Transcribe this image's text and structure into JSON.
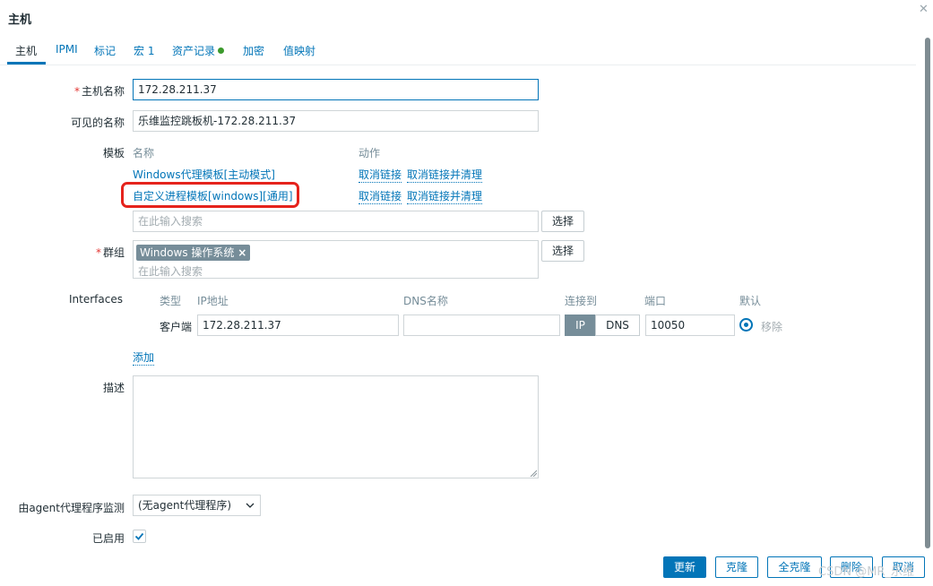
{
  "dialog": {
    "title": "主机",
    "close_icon": "close-icon"
  },
  "tabs": [
    {
      "label": "主机",
      "active": true
    },
    {
      "label": "IPMI"
    },
    {
      "label": "标记"
    },
    {
      "label": "宏 1"
    },
    {
      "label": "资产记录",
      "status_dot_color": "#3c9a2c"
    },
    {
      "label": "加密"
    },
    {
      "label": "值映射"
    }
  ],
  "form": {
    "host_name": {
      "required_mark": "*",
      "label": "主机名称",
      "value": "172.28.211.37"
    },
    "visible_name": {
      "label": "可见的名称",
      "value": "乐维监控跳板机-172.28.211.37"
    },
    "templates": {
      "label": "模板",
      "col_name": "名称",
      "col_action": "动作",
      "rows": [
        {
          "name": "Windows代理模板[主动模式]",
          "unlink": "取消链接",
          "unlink_clear": "取消链接并清理"
        },
        {
          "name": "自定义进程模板[windows][通用]",
          "unlink": "取消链接",
          "unlink_clear": "取消链接并清理"
        }
      ],
      "search_placeholder": "在此输入搜索",
      "select_button": "选择"
    },
    "groups": {
      "required_mark": "*",
      "label": "群组",
      "chip": "Windows 操作系统",
      "chip_remove": "×",
      "search_placeholder": "在此输入搜索",
      "select_button": "选择"
    },
    "interfaces": {
      "label": "Interfaces",
      "headers": {
        "type": "类型",
        "ip": "IP地址",
        "dns": "DNS名称",
        "connect": "连接到",
        "port": "端口",
        "default": "默认"
      },
      "row": {
        "type": "客户端",
        "ip": "172.28.211.37",
        "dns": "",
        "ip_btn": "IP",
        "dns_btn": "DNS",
        "port": "10050",
        "remove": "移除"
      },
      "add_link": "添加"
    },
    "description": {
      "label": "描述",
      "value": ""
    },
    "monitored_by": {
      "label": "由agent代理程序监测",
      "value": "(无agent代理程序)"
    },
    "enabled": {
      "label": "已启用",
      "checked": true
    }
  },
  "footer": {
    "update": "更新",
    "clone": "克隆",
    "full_clone": "全克隆",
    "delete": "删除",
    "cancel": "取消"
  },
  "watermark": "CSDN @MR_乐维",
  "colors": {
    "accent": "#0275b8",
    "highlight_box": "#e5231c",
    "status_green": "#3c9a2c"
  }
}
